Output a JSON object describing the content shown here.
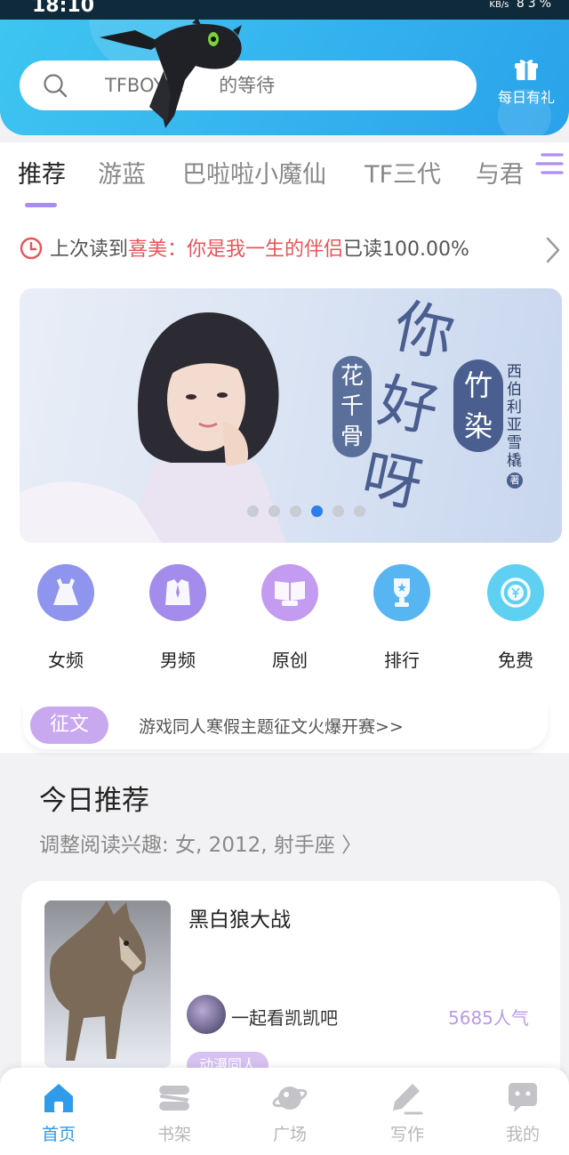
{
  "status_bar": {
    "time": "18:10",
    "speed": "KB/s",
    "battery": "83%"
  },
  "header": {
    "search_placeholder": "TFBOYS：    的等待",
    "gift_label": "每日有礼"
  },
  "tabs": [
    {
      "label": "推荐",
      "active": true
    },
    {
      "label": "游蓝",
      "active": false
    },
    {
      "label": "巴啦啦小魔仙",
      "active": false
    },
    {
      "label": "TF三代",
      "active": false
    },
    {
      "label": "与君",
      "active": false
    }
  ],
  "last_read": {
    "prefix": "上次读到",
    "title": "喜美：你是我一生的伴侣",
    "progress": "已读100.00%"
  },
  "banner": {
    "title_main": "你好呀",
    "title_sub1": "花千骨",
    "title_sub2": "竹染",
    "author": "西伯利亚雪橇",
    "author_suffix": "著",
    "dots_count": 6,
    "active_dot": 4
  },
  "categories": [
    {
      "label": "女频",
      "icon": "dress-icon",
      "color": "#8f94ee"
    },
    {
      "label": "男频",
      "icon": "shirt-icon",
      "color": "#a48cec"
    },
    {
      "label": "原创",
      "icon": "book-icon",
      "color": "#c39bf0"
    },
    {
      "label": "排行",
      "icon": "trophy-icon",
      "color": "#57b5f2"
    },
    {
      "label": "免费",
      "icon": "coin-icon",
      "color": "#5fd0f2"
    }
  ],
  "contest": {
    "badge": "征文",
    "text": "游戏同人寒假主题征文火爆开赛>>"
  },
  "today": {
    "title": "今日推荐",
    "subtitle": "调整阅读兴趣: 女, 2012, 射手座 〉"
  },
  "book_card": {
    "title": "黑白狼大战",
    "author": "一起看凯凯吧",
    "popularity": "5685人气",
    "tag": "动漫同人"
  },
  "bottom_nav": [
    {
      "label": "首页",
      "icon": "home-icon",
      "active": true
    },
    {
      "label": "书架",
      "icon": "bookshelf-icon",
      "active": false
    },
    {
      "label": "广场",
      "icon": "planet-icon",
      "active": false
    },
    {
      "label": "写作",
      "icon": "pencil-icon",
      "active": false
    },
    {
      "label": "我的",
      "icon": "chat-profile-icon",
      "active": false
    }
  ],
  "colors": {
    "header_start": "#3fc6f0",
    "header_end": "#2aa2ea",
    "accent_purple": "#a88df0",
    "highlight_red": "#e8545a",
    "nav_active": "#2f9be9"
  }
}
